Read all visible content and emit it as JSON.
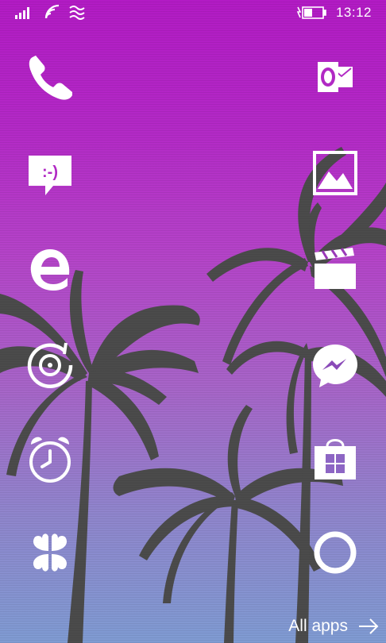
{
  "status_bar": {
    "icons": [
      "signal-bars-icon",
      "wifi-icon",
      "network-waves-icon",
      "battery-charging-icon"
    ],
    "time": "13:12"
  },
  "tiles_left": [
    "phone-icon",
    "messaging-icon",
    "edge-icon",
    "groove-music-icon",
    "alarms-icon",
    "clover-app-icon"
  ],
  "tiles_right": [
    "outlook-icon",
    "photos-icon",
    "movies-tv-icon",
    "messenger-icon",
    "store-icon",
    "cortana-icon"
  ],
  "footer": {
    "all_apps_label": "All apps"
  },
  "colors": {
    "sky_top": "#b21bc4",
    "sky_bottom": "#7f9bd2",
    "palms": "#4a4a4a",
    "glyph": "#ffffff"
  }
}
